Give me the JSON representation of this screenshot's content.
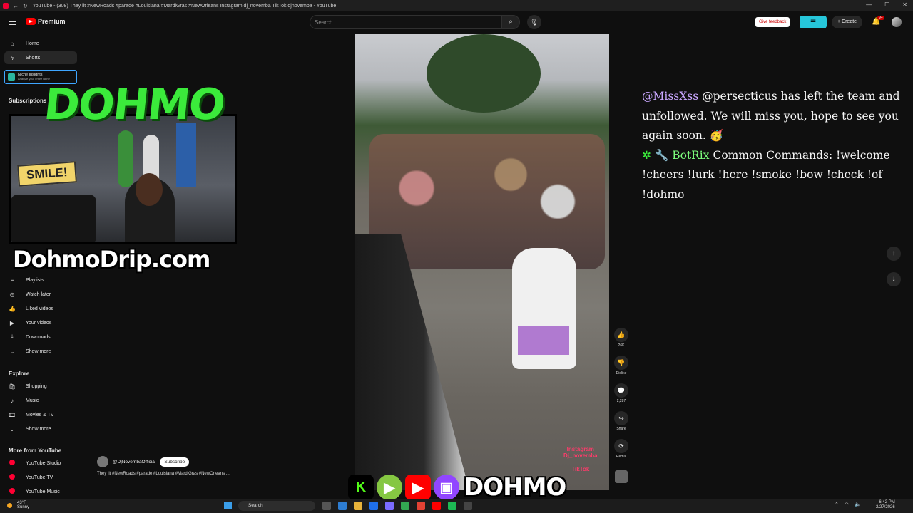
{
  "window": {
    "title": "YouTube - (308) They lit #NewRoads #parade #Louisiana #MardiGras #NewOrleans Instagram:dj_novemba TikTok:djnovemba - YouTube"
  },
  "header": {
    "logo_text": "Premium",
    "search_placeholder": "Search",
    "feedback_label": "Give feedback",
    "create_label": "Create",
    "notification_count": "9+"
  },
  "sidebar": {
    "home": "Home",
    "shorts": "Shorts",
    "niche_title": "Niche Insights",
    "niche_sub": "Analyze your entire niche",
    "subscriptions_heading": "Subscriptions",
    "you_items": [
      "Playlists",
      "Watch later",
      "Liked videos",
      "Your videos",
      "Downloads",
      "Show more"
    ],
    "explore_heading": "Explore",
    "explore_items": [
      "Shopping",
      "Music",
      "Movies & TV",
      "Show more"
    ],
    "more_heading": "More from YouTube",
    "more_items": [
      "YouTube Studio",
      "YouTube TV",
      "YouTube Music"
    ]
  },
  "overlay": {
    "brand": "DOHMO",
    "site": "DohmoDrip.com",
    "webcam_sign": "SMILE!"
  },
  "video": {
    "watermark_line1": "Instagram",
    "watermark_line2": "Dj_novemba",
    "watermark_line3": "TikTok",
    "channel_name": "@DjNovembaOfficial",
    "subscribe_label": "Subscribe",
    "short_title": "They lit #NewRoads #parade #Louisiana #MardiGras #NewOrleans ..."
  },
  "actions": {
    "like_count": "26K",
    "dislike_label": "Dislike",
    "comment_count": "2,287",
    "share_label": "Share",
    "remix_label": "Remix"
  },
  "chat": {
    "msg1_user": "@MissXss",
    "msg1_text": "@persecticus has left the team and unfollowed. We will miss you, hope to see you again soon.",
    "msg2_user": "BotRix",
    "msg2_text": "Common Commands: !welcome !cheers !lurk !here !smoke !bow !check !of !dohmo"
  },
  "brandbar": {
    "kick_letter": "K",
    "text": "DOHMO"
  },
  "taskbar": {
    "temp": "43°F",
    "weather": "Sunny",
    "search_label": "Search",
    "time": "6:42 PM",
    "date": "2/27/2026"
  },
  "colors": {
    "accent_green": "#3bea3b",
    "youtube_red": "#ff0000",
    "chat_user1": "#c9a7ff",
    "chat_user2": "#7dff7d"
  }
}
